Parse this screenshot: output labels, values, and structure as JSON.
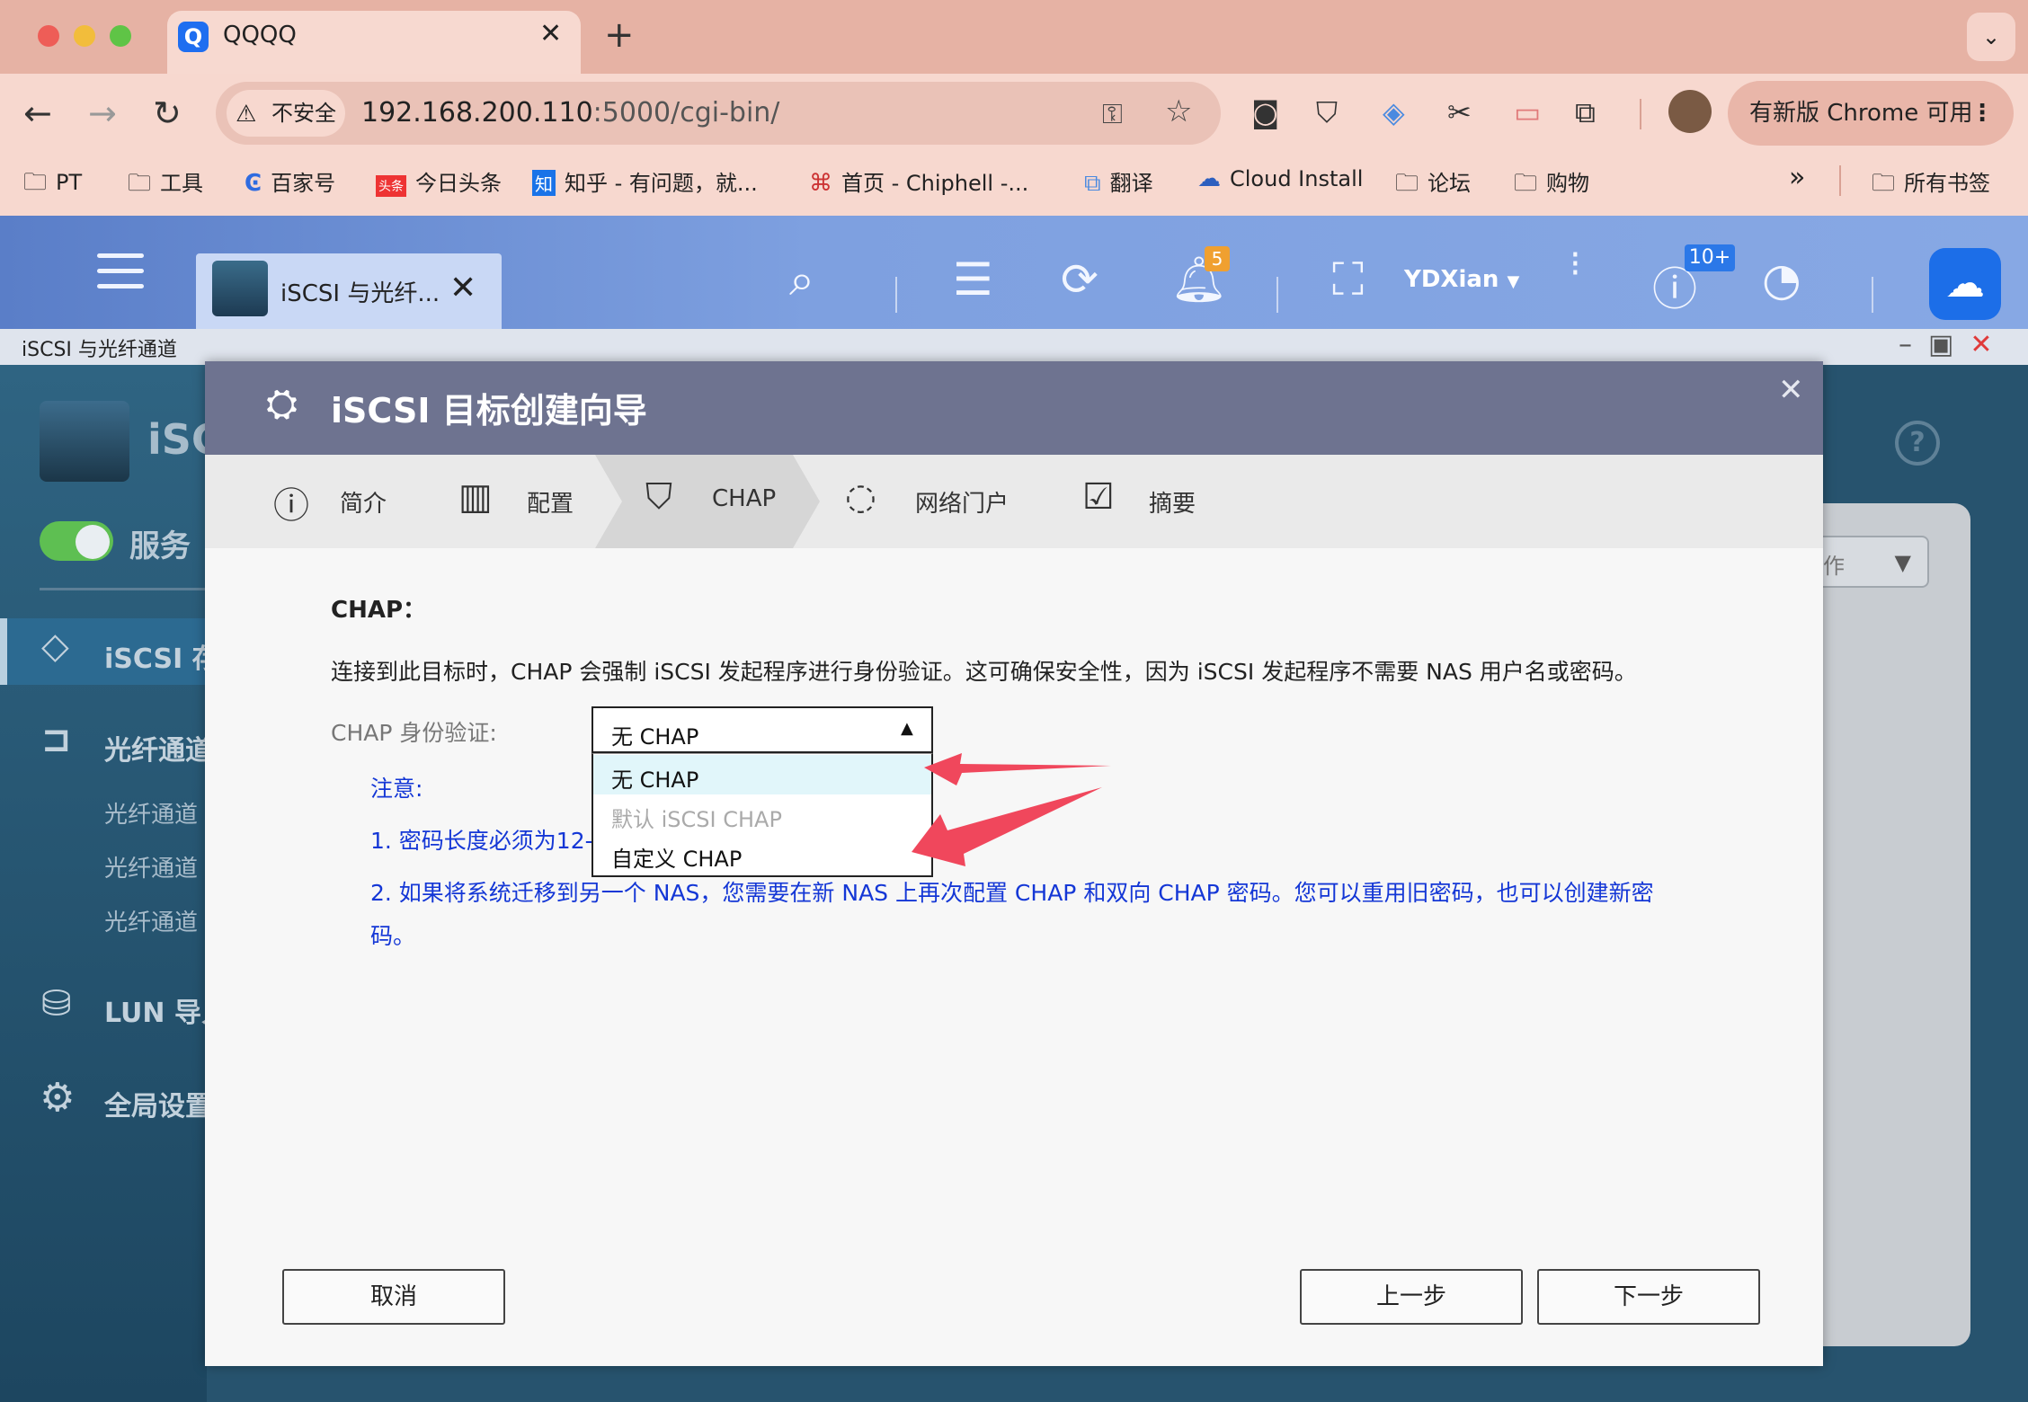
{
  "browser": {
    "tab_title": "QQQQ",
    "tab_favicon": "Q",
    "security_label": "不安全",
    "url_host": "192.168.200.110",
    "url_path": ":5000/cgi-bin/",
    "update_button": "有新版 Chrome 可用",
    "bookmarks": [
      {
        "label": "PT",
        "icon": "folder-icon"
      },
      {
        "label": "工具",
        "icon": "folder-icon"
      },
      {
        "label": "百家号",
        "icon": "baijiahao-icon"
      },
      {
        "label": "今日头条",
        "icon": "toutiao-icon"
      },
      {
        "label": "知乎 - 有问题，就...",
        "icon": "zhihu-icon"
      },
      {
        "label": "首页 - Chiphell -...",
        "icon": "chiphell-icon"
      },
      {
        "label": "翻译",
        "icon": "translate-icon"
      },
      {
        "label": "Cloud Install",
        "icon": "cloud-icon"
      },
      {
        "label": "论坛",
        "icon": "folder-icon"
      },
      {
        "label": "购物",
        "icon": "folder-icon"
      }
    ],
    "all_bookmarks": "所有书签",
    "more_bookmarks": "»"
  },
  "qnap": {
    "app_tab_label": "iSCSI 与光纤...",
    "notification_count": "5",
    "user_name": "YDXian",
    "info_count": "10+",
    "window_title": "iSCSI 与光纤通道"
  },
  "background_app": {
    "app_name": "iSC",
    "service_label": "服务",
    "sidebar": {
      "iscsi_storage": "iSCSI 存",
      "fc": "光纤通道",
      "fc_sub": [
        "光纤通道",
        "光纤通道",
        "光纤通道"
      ],
      "lun_import": "LUN 导入",
      "global_settings": "全局设置"
    },
    "action_select": "作"
  },
  "dialog": {
    "title": "iSCSI 目标创建向导",
    "steps": [
      {
        "label": "简介",
        "icon": "info-icon"
      },
      {
        "label": "配置",
        "icon": "config-icon"
      },
      {
        "label": "CHAP",
        "icon": "shield-icon",
        "active": true
      },
      {
        "label": "网络门户",
        "icon": "network-icon"
      },
      {
        "label": "摘要",
        "icon": "summary-icon"
      }
    ],
    "chap_heading": "CHAP：",
    "chap_description": "连接到此目标时，CHAP 会强制 iSCSI 发起程序进行身份验证。这可确保安全性，因为 iSCSI 发起程序不需要 NAS 用户名或密码。",
    "auth_label": "CHAP 身份验证:",
    "auth_selected": "无 CHAP",
    "auth_options": [
      "无 CHAP",
      "默认 iSCSI CHAP",
      "自定义 CHAP"
    ],
    "note_title": "注意:",
    "note_1": "1. 密码长度必须为12-",
    "note_2_line1": "2. 如果将系统迁移到另一个 NAS，您需要在新 NAS 上再次配置 CHAP 和双向 CHAP 密码。您可以重用旧密码，也可以创建新密",
    "note_2_line2": "码。",
    "cancel": "取消",
    "prev": "上一步",
    "next": "下一步"
  },
  "colors": {
    "chrome_frame": "#e6b2a4",
    "qnap_bar": "#7ea0e0",
    "dialog_header": "#6e7390",
    "note_text": "#1437d6",
    "annotation_arrow": "#f0475c"
  }
}
